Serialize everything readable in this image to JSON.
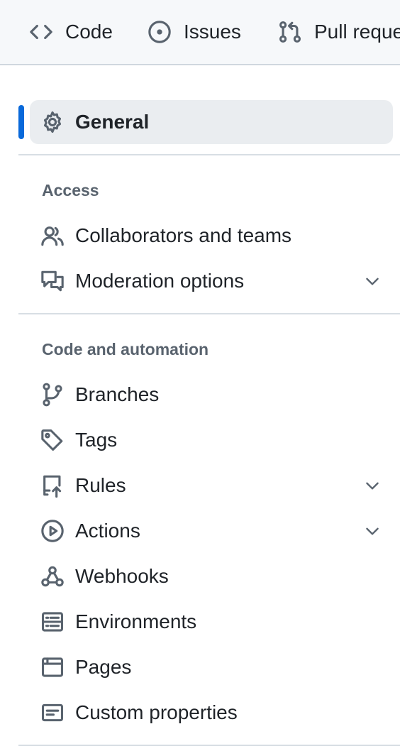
{
  "repo_nav": {
    "tabs": [
      {
        "label": "Code",
        "icon": "code-icon"
      },
      {
        "label": "Issues",
        "icon": "issue-opened-icon"
      },
      {
        "label": "Pull reque",
        "icon": "git-pull-request-icon"
      }
    ]
  },
  "settings_nav": {
    "general": {
      "label": "General",
      "icon": "gear-icon",
      "selected": true
    },
    "sections": [
      {
        "heading": "Access",
        "items": [
          {
            "label": "Collaborators and teams",
            "icon": "people-icon",
            "expandable": false
          },
          {
            "label": "Moderation options",
            "icon": "comment-discussion-icon",
            "expandable": true
          }
        ]
      },
      {
        "heading": "Code and automation",
        "items": [
          {
            "label": "Branches",
            "icon": "git-branch-icon",
            "expandable": false
          },
          {
            "label": "Tags",
            "icon": "tag-icon",
            "expandable": false
          },
          {
            "label": "Rules",
            "icon": "repo-push-icon",
            "expandable": true
          },
          {
            "label": "Actions",
            "icon": "play-icon",
            "expandable": true
          },
          {
            "label": "Webhooks",
            "icon": "webhook-icon",
            "expandable": false
          },
          {
            "label": "Environments",
            "icon": "server-icon",
            "expandable": false
          },
          {
            "label": "Pages",
            "icon": "browser-icon",
            "expandable": false
          },
          {
            "label": "Custom properties",
            "icon": "note-icon",
            "expandable": false
          }
        ]
      }
    ]
  },
  "colors": {
    "accent": "#0969da",
    "selected_bg": "#eaedf0",
    "muted_text": "#59636e"
  }
}
